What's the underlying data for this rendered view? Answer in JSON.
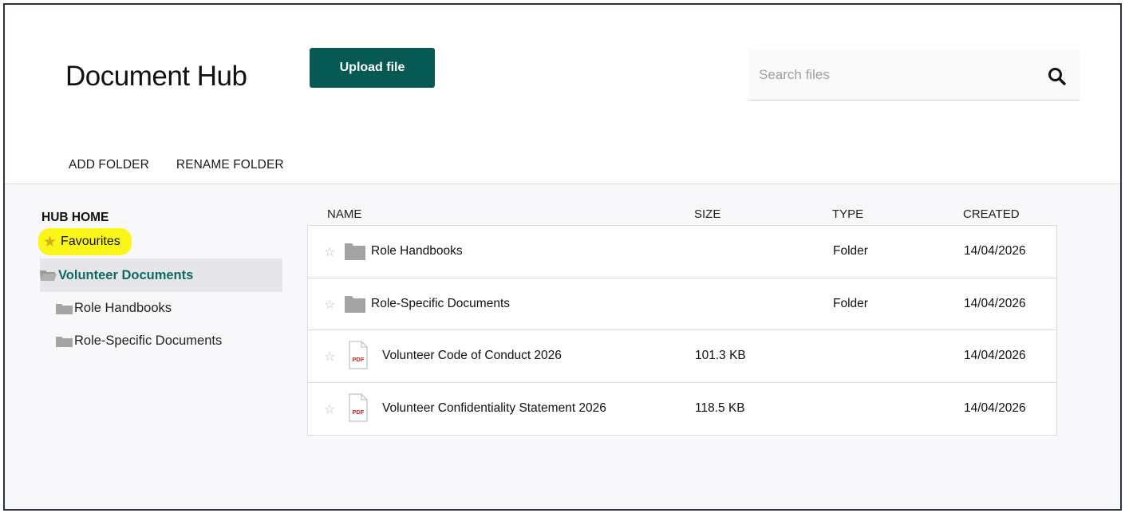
{
  "app": {
    "title": "Document Hub"
  },
  "header": {
    "upload_label": "Upload file"
  },
  "search": {
    "placeholder": "Search files"
  },
  "toolbar": {
    "add_folder": "ADD FOLDER",
    "rename_folder": "RENAME FOLDER"
  },
  "sidebar": {
    "home_label": "HUB HOME",
    "favourites_label": "Favourites",
    "items": [
      {
        "label": "Volunteer Documents",
        "icon": "folder-open-icon",
        "active": true
      },
      {
        "label": "Role Handbooks",
        "icon": "folder-icon",
        "active": false
      },
      {
        "label": "Role-Specific Documents",
        "icon": "folder-icon",
        "active": false
      }
    ]
  },
  "table": {
    "columns": {
      "name": "NAME",
      "size": "SIZE",
      "type": "TYPE",
      "created": "CREATED"
    },
    "rows": [
      {
        "icon": "folder-icon",
        "name": "Role Handbooks",
        "size": "",
        "type": "Folder",
        "created": "14/04/2026"
      },
      {
        "icon": "folder-icon",
        "name": "Role-Specific Documents",
        "size": "",
        "type": "Folder",
        "created": "14/04/2026"
      },
      {
        "icon": "pdf-icon",
        "icon_text": "PDF",
        "name": "Volunteer Code of Conduct 2026",
        "size": "101.3 KB",
        "type": "",
        "created": "14/04/2026"
      },
      {
        "icon": "pdf-icon",
        "icon_text": "PDF",
        "name": "Volunteer Confidentiality Statement 2026",
        "size": "118.5 KB",
        "type": "",
        "created": "14/04/2026"
      }
    ]
  },
  "colors": {
    "accent": "#065a53",
    "active_text": "#0e6b63",
    "highlight": "#fbf61a",
    "star_icon": "#d0b11a",
    "folder_icon": "#a3a3a3",
    "pdf_text": "#d9251d"
  }
}
